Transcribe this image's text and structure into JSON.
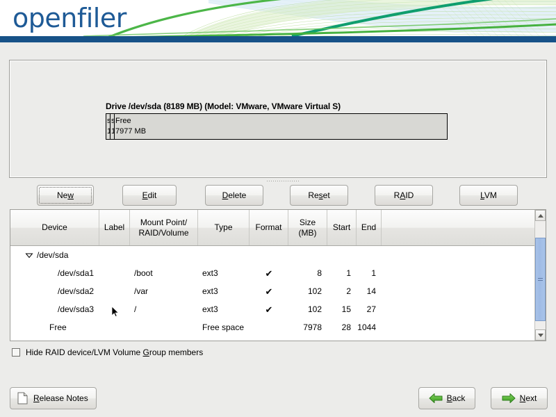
{
  "app": {
    "brand": "openfiler",
    "accent_blue": "#175288",
    "accent_green": "#44ad3a",
    "logo_color": "#1e5a96"
  },
  "drive": {
    "title": "Drive /dev/sda (8189 MB) (Model: VMware, VMware Virtual S)",
    "partitions": [
      {
        "name": "s",
        "size": "1",
        "narrow": true
      },
      {
        "name": "s",
        "size": "1",
        "narrow": true
      },
      {
        "name": "Free",
        "size": "7977 MB",
        "narrow": false
      }
    ]
  },
  "toolbar": {
    "new_label": "New",
    "new_mnemonic": "w",
    "edit_label": "Edit",
    "edit_mnemonic": "E",
    "delete_label": "Delete",
    "delete_mnemonic": "D",
    "reset_label": "Reset",
    "reset_mnemonic": "s",
    "raid_label": "RAID",
    "raid_mnemonic": "A",
    "lvm_label": "LVM",
    "lvm_mnemonic": "L"
  },
  "table": {
    "columns": [
      {
        "label": "Device"
      },
      {
        "label": "Label"
      },
      {
        "label": "Mount Point/",
        "label2": "RAID/Volume"
      },
      {
        "label": "Type"
      },
      {
        "label": "Format"
      },
      {
        "label": "Size",
        "label2": "(MB)"
      },
      {
        "label": "Start"
      },
      {
        "label": "End"
      },
      {
        "label": ""
      }
    ],
    "rows": [
      {
        "kind": "group",
        "device": "/dev/sda",
        "label": "",
        "mount": "",
        "type": "",
        "format": "",
        "size": "",
        "start": "",
        "end": "",
        "expanded": true
      },
      {
        "kind": "partition",
        "device": "/dev/sda1",
        "label": "",
        "mount": "/boot",
        "type": "ext3",
        "format": "✔",
        "size": "8",
        "start": "1",
        "end": "1"
      },
      {
        "kind": "partition",
        "device": "/dev/sda2",
        "label": "",
        "mount": "/var",
        "type": "ext3",
        "format": "✔",
        "size": "102",
        "start": "2",
        "end": "14"
      },
      {
        "kind": "partition",
        "device": "/dev/sda3",
        "label": "",
        "mount": "/",
        "type": "ext3",
        "format": "✔",
        "size": "102",
        "start": "15",
        "end": "27"
      },
      {
        "kind": "free",
        "device": "Free",
        "label": "",
        "mount": "",
        "type": "Free space",
        "format": "",
        "size": "7978",
        "start": "28",
        "end": "1044"
      }
    ]
  },
  "options": {
    "hide_members_label": "Hide RAID device/LVM Volume Group members",
    "hide_members_mnemonic": "G",
    "hide_members_checked": false
  },
  "footer": {
    "release_notes_label": "Release Notes",
    "release_notes_mnemonic": "R",
    "back_label": "Back",
    "back_mnemonic": "B",
    "next_label": "Next",
    "next_mnemonic": "N"
  }
}
